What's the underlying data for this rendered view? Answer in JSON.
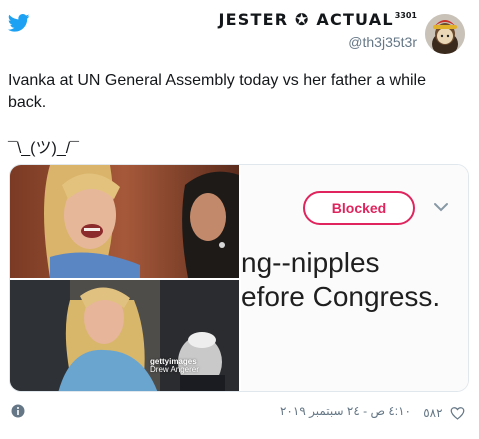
{
  "author": {
    "display_name": "JESTER ✪ ACTUAL",
    "display_name_sup": "3301",
    "handle": "@th3j35t3r"
  },
  "tweet": {
    "text": "Ivanka at UN General Assembly today vs her father a while back.",
    "shrug": "¯\\_(ツ)_/¯"
  },
  "media": {
    "right_panel": {
      "button_label": "Blocked",
      "cropped_text_line1": "ng--nipples",
      "cropped_text_line2": "efore Congress."
    },
    "watermark": {
      "brand": "gettyimages",
      "credit": "Drew Angerer"
    }
  },
  "footer": {
    "timestamp": "٤:١٠ ص - ٢٤ سبتمبر ٢٠١٩",
    "like_count": "٥٨٢"
  },
  "colors": {
    "twitter_blue": "#1da1f2",
    "blocked_red": "#e0245e",
    "secondary_text": "#657786"
  },
  "icons": [
    "twitter-bird-icon",
    "avatar",
    "chevron-down-icon",
    "info-icon",
    "heart-icon"
  ]
}
